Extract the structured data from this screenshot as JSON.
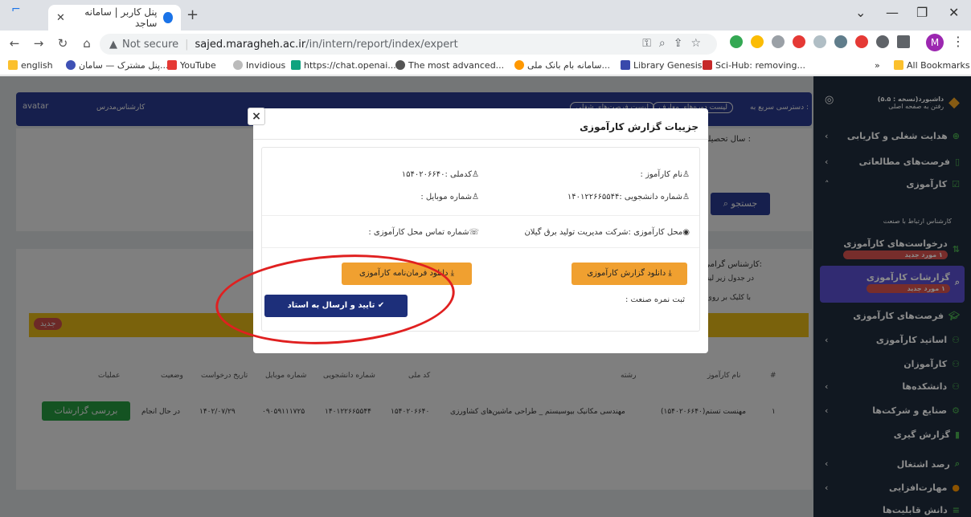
{
  "browser": {
    "tab_title": "پنل کاربر | سامانه ساجد",
    "new_tab": "+",
    "url_warning": "Not secure",
    "url_host": "sajed.maragheh.ac.ir",
    "url_path": "/in/intern/report/index/expert",
    "profile_initial": "M",
    "bookmarks": [
      "english",
      "پنل مشترک — سامان...",
      "YouTube",
      "Invidious",
      "https://chat.openai...",
      "The most advanced...",
      "سامانه بام بانک ملی...",
      "Library Genesis",
      "Sci-Hub: removing...",
      "»",
      "All Bookmarks"
    ]
  },
  "header": {
    "avatar_text": "avatar",
    "role": "کارشناس‌مدرس",
    "quick_access": "دسترسی سریع به :",
    "quick_link1": "لیست دوره‌های معارف",
    "quick_link2": "لیست فرصت‌های شغلی"
  },
  "filter": {
    "year_label": "سال تحصیلی :",
    "search_label": "جستجو"
  },
  "notice": {
    "title": "کارشناس گرامی:",
    "line1": "در جدول زیر لیست",
    "line2": "با کلیک بر روی گ"
  },
  "table": {
    "new_badge": "جدید",
    "headers": [
      "#",
      "نام کارآموز",
      "رشته",
      "کد ملی",
      "شماره دانشجویی",
      "شماره موبایل",
      "تاریخ درخواست",
      "وضعیت",
      "عملیات"
    ],
    "row": [
      "۱",
      "مهنست تستم(۱۵۴۰۲۰۶۶۴۰)",
      "مهندسی مکانیک بیوسیستم _ طراحی ماشین‌های کشاورزی",
      "۱۵۴۰۲۰۶۶۴۰",
      "۱۴۰۱۲۲۶۶۵۵۴۴",
      "۰۹۰۵۹۱۱۱۷۲۵",
      "۱۴۰۲/۰۷/۲۹",
      "در حال انجام"
    ],
    "review_btn": "بررسی گزارشات"
  },
  "sidebar": {
    "dashboard": "داشبورد(نسخه : ۵.۵)",
    "dashboard_sub": "رفتن به صفحه اصلی",
    "items": [
      "هدایت شغلی و کاریابی",
      "فرصت‌های مطالعاتی",
      "کارآموزی",
      "کارشناس ارتباط با صنعت",
      "درخواست‌های کارآموزی",
      "گزارشات کارآموزی",
      "فرصت‌های کارآموزی",
      "اساتید کارآموزی",
      "کارآموزان",
      "دانشکده‌ها",
      "صنایع و شرکت‌ها",
      "گزارش گیری",
      "رصد اشتغال",
      "مهارت‌افزایی",
      "دانش قابلیت‌ها"
    ],
    "badge1": "۱ مورد جدید",
    "badge2": "۱ مورد جدید"
  },
  "modal": {
    "close": "×",
    "title": "جزییات گزارش کارآموزی",
    "student_name": "نام کارآموز :",
    "national_code": "کدملی :۱۵۴۰۲۰۶۶۴۰",
    "student_number": "شماره دانشجویی :۱۴۰۱۲۲۶۶۵۵۴۴",
    "mobile": "شماره موبایل :",
    "location": "محل کارآموزی :شرکت مدیریت تولید برق گیلان",
    "location_phone": "شماره تماس محل کارآموزی :",
    "download_report": "دانلود گزارش کارآموزی",
    "download_letter": "دانلود فرمان‌نامه کارآموزی",
    "industry_score": "ثبت نمره صنعت :",
    "confirm_send": "تایید و ارسال به استاد"
  }
}
